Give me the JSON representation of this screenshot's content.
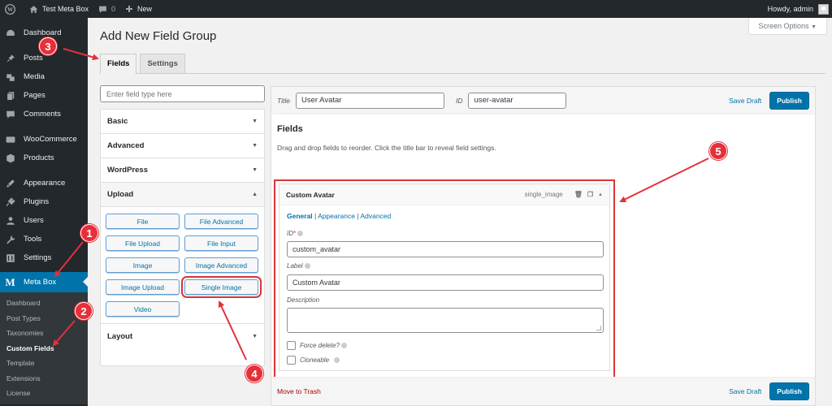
{
  "adminbar": {
    "site_name": "Test Meta Box",
    "comments_count": "0",
    "new_label": "New",
    "howdy": "Howdy, admin"
  },
  "sidebar": {
    "items": [
      {
        "label": "Dashboard",
        "icon": "dashboard-icon"
      },
      {
        "label": "Posts",
        "icon": "pin-icon"
      },
      {
        "label": "Media",
        "icon": "media-icon"
      },
      {
        "label": "Pages",
        "icon": "pages-icon"
      },
      {
        "label": "Comments",
        "icon": "comment-icon"
      },
      {
        "label": "WooCommerce",
        "icon": "woo-icon"
      },
      {
        "label": "Products",
        "icon": "box-icon"
      },
      {
        "label": "Appearance",
        "icon": "brush-icon"
      },
      {
        "label": "Plugins",
        "icon": "plugin-icon"
      },
      {
        "label": "Users",
        "icon": "user-icon"
      },
      {
        "label": "Tools",
        "icon": "wrench-icon"
      },
      {
        "label": "Settings",
        "icon": "settings-icon"
      },
      {
        "label": "Meta Box",
        "icon": "metabox-icon",
        "active": true
      }
    ],
    "submenu": [
      {
        "label": "Dashboard"
      },
      {
        "label": "Post Types"
      },
      {
        "label": "Taxonomies"
      },
      {
        "label": "Custom Fields",
        "current": true
      },
      {
        "label": "Template"
      },
      {
        "label": "Extensions"
      },
      {
        "label": "License"
      }
    ]
  },
  "header": {
    "screen_options": "Screen Options",
    "title": "Add New Field Group",
    "tabs": [
      {
        "label": "Fields",
        "active": true
      },
      {
        "label": "Settings"
      }
    ]
  },
  "field_types": {
    "search_placeholder": "Enter field type here",
    "groups": [
      {
        "label": "Basic",
        "open": false
      },
      {
        "label": "Advanced",
        "open": false
      },
      {
        "label": "WordPress",
        "open": false
      },
      {
        "label": "Upload",
        "open": true,
        "buttons": [
          "File",
          "File Advanced",
          "File Upload",
          "File Input",
          "Image",
          "Image Advanced",
          "Image Upload",
          "Single Image",
          "Video"
        ],
        "highlighted": "Single Image"
      },
      {
        "label": "Layout",
        "open": false
      }
    ]
  },
  "editor": {
    "title_label": "Title",
    "title_value": "User Avatar",
    "id_label": "ID",
    "id_value": "user-avatar",
    "save_draft": "Save Draft",
    "publish": "Publish",
    "fields_heading": "Fields",
    "fields_hint": "Drag and drop fields to reorder. Click the title bar to reveal field settings.",
    "field": {
      "name": "Custom Avatar",
      "type": "single_image",
      "tabs": [
        "General",
        "Appearance",
        "Advanced"
      ],
      "active_tab": "General",
      "id_label": "ID",
      "id_required": "*",
      "id_value": "custom_avatar",
      "label_label": "Label",
      "label_value": "Custom Avatar",
      "description_label": "Description",
      "description_value": "",
      "force_delete_label": "Force delete?",
      "force_delete_checked": false,
      "cloneable_label": "Cloneable",
      "cloneable_checked": false
    },
    "move_to_trash": "Move to Trash"
  },
  "annotations": {
    "badges": [
      "1",
      "2",
      "3",
      "4",
      "5"
    ],
    "color": "#e5303a"
  }
}
